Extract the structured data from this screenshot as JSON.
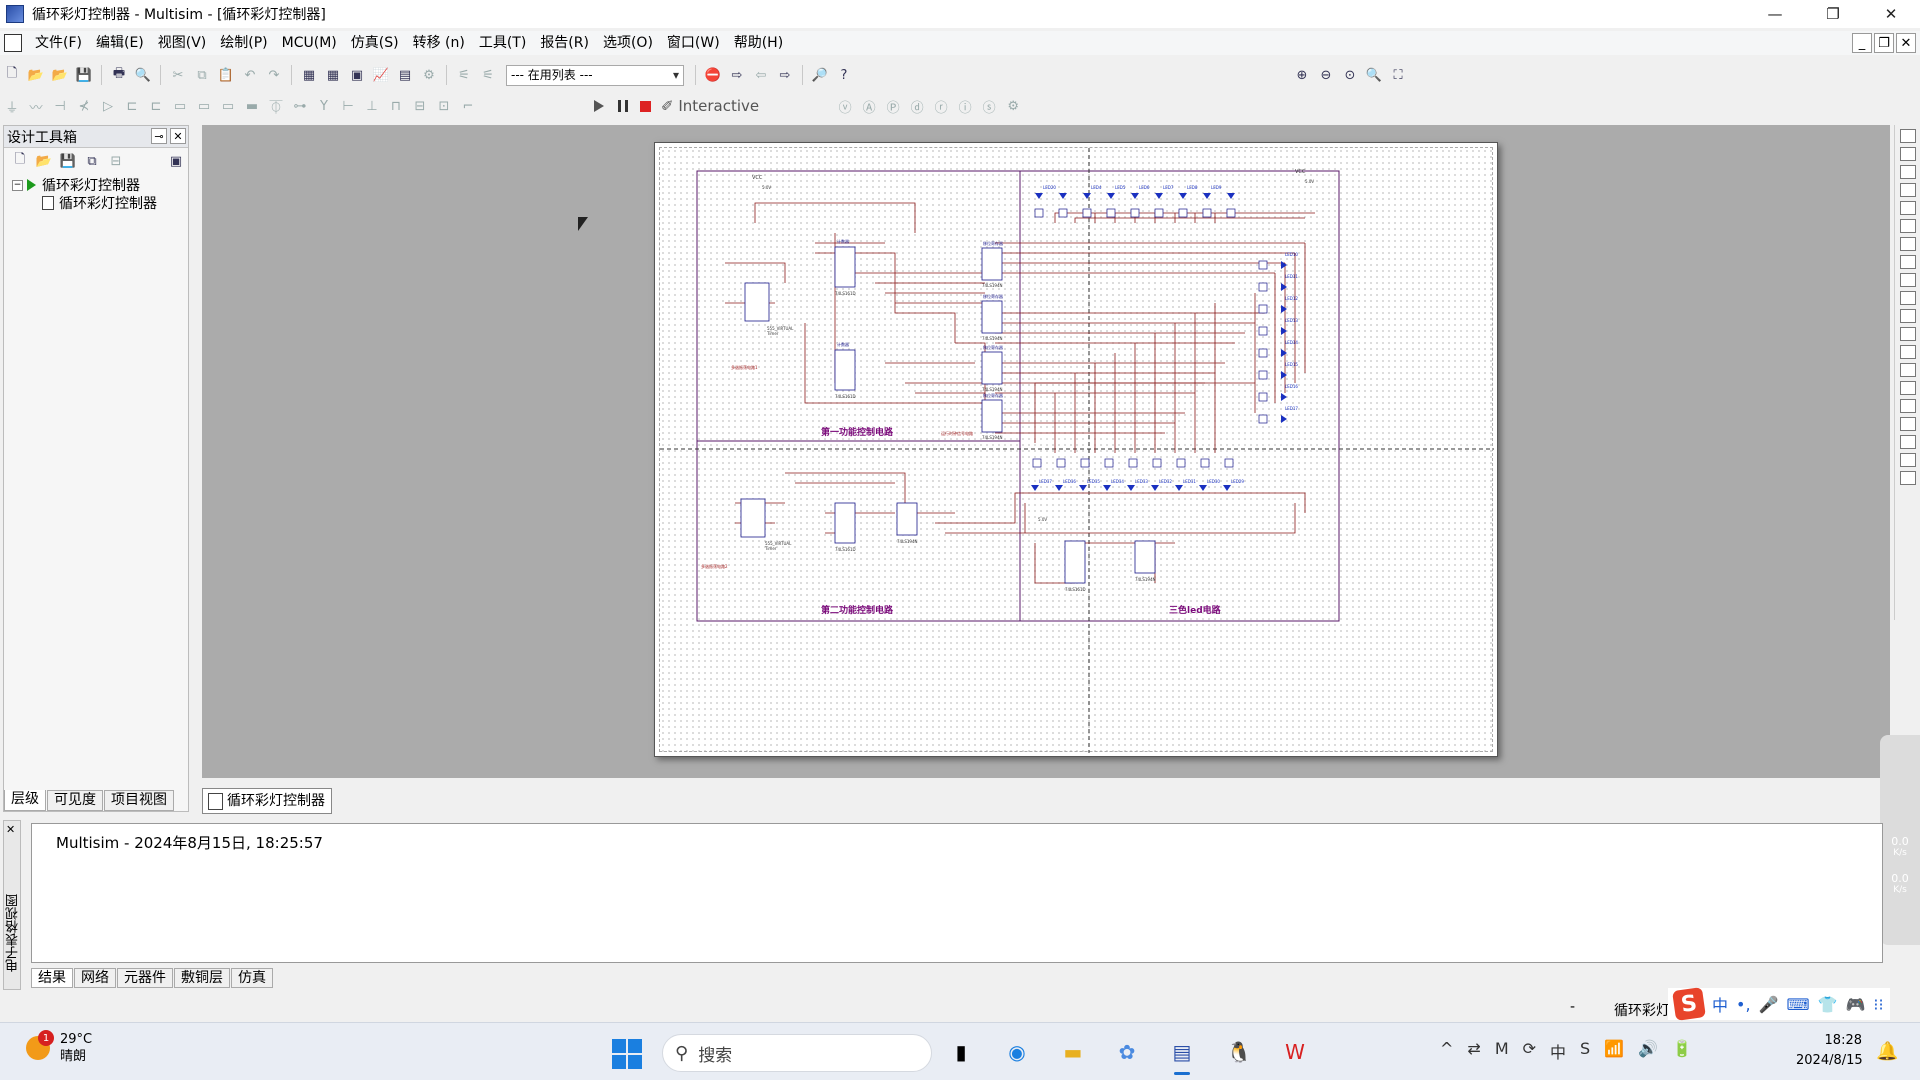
{
  "window": {
    "title": "循环彩灯控制器 - Multisim - [循环彩灯控制器]",
    "controls": {
      "minimize": "—",
      "restore": "❐",
      "close": "✕"
    }
  },
  "menu": {
    "items": [
      "文件(F)",
      "编辑(E)",
      "视图(V)",
      "绘制(P)",
      "MCU(M)",
      "仿真(S)",
      "转移 (n)",
      "工具(T)",
      "报告(R)",
      "选项(O)",
      "窗口(W)",
      "帮助(H)"
    ]
  },
  "toolbar": {
    "inuse_combo": "--- 在用列表 ---",
    "sim_mode": "Interactive"
  },
  "toolbox": {
    "title": "设计工具箱",
    "tree": {
      "root": "循环彩灯控制器",
      "child": "循环彩灯控制器"
    },
    "tabs": [
      "层级",
      "可见度",
      "项目视图"
    ]
  },
  "schematic": {
    "section1": "第一功能控制电路",
    "section2": "第二功能控制电路",
    "section3": "三色led电路",
    "vcc": "VCC",
    "v5": "5.0V",
    "timer_label": "555_VIRTUAL",
    "timer_sub": "Timer",
    "chip_counter": "74LS161D",
    "chip_register": "74LS194N",
    "gate": "AND2",
    "astable_label": "多谐振荡电路1",
    "astable_label2": "多谐振荡电路2",
    "counter_title": "计数器",
    "shift_title": "移位寄存器",
    "sync_label": "运行时钟信号电路",
    "led_top": [
      "LED20",
      "LED4",
      "LED5",
      "LED6",
      "LED7",
      "LED8",
      "LED9"
    ],
    "led_right": [
      "LED10",
      "LED11",
      "LED12",
      "LED13",
      "LED14",
      "LED15",
      "LED16",
      "LED17",
      "LED18",
      "LED19"
    ],
    "led_bottom": [
      "LED37",
      "LED36",
      "LED35",
      "LED34",
      "LED33",
      "LED32",
      "LED31",
      "LED30",
      "LED29"
    ]
  },
  "document_tab": "循环彩灯控制器",
  "output": {
    "log_line": "Multisim  -  2024年8月15日, 18:25:57",
    "side_label": "电子表格视图",
    "tabs": [
      "结果",
      "网络",
      "元器件",
      "敷铜层",
      "仿真"
    ]
  },
  "status": {
    "dash": "-",
    "text": "循环彩灯"
  },
  "ime": {
    "logo": "S",
    "items": [
      "中",
      "•,",
      "🎤",
      "⌨",
      "👕",
      "🎮",
      "⁝⁝"
    ]
  },
  "netmeter": {
    "up": "0.0",
    "down": "0.0",
    "unit": "K/s"
  },
  "taskbar": {
    "weather_temp": "29°C",
    "weather_desc": "晴朗",
    "weather_badge": "1",
    "search_placeholder": "搜索",
    "time": "18:28",
    "date": "2024/8/15"
  },
  "colors": {
    "wire": "#8b1a1a",
    "section_border": "#5a1a6a",
    "section_text": "#7a0a7a",
    "chip": "#1a1a8a",
    "led": "#1a30c0"
  }
}
